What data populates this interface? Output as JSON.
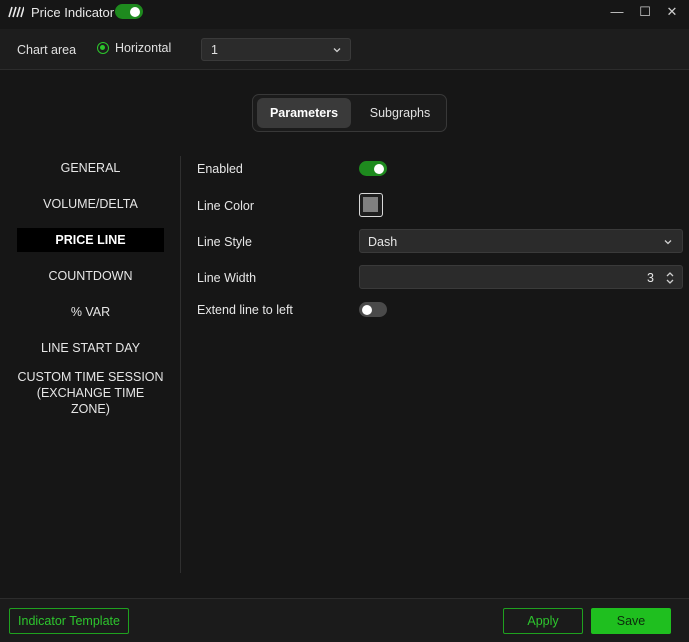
{
  "window": {
    "title": "Price Indicator",
    "enabled": true,
    "controls": {
      "minimize": "—",
      "maximize": "☐",
      "close": "✕"
    }
  },
  "chart_area": {
    "label": "Chart area",
    "radio_label": "Horizontal",
    "radio_selected": true,
    "select_value": "1"
  },
  "tabs": [
    {
      "label": "Parameters",
      "active": true
    },
    {
      "label": "Subgraphs",
      "active": false
    }
  ],
  "nav": [
    {
      "label": "GENERAL",
      "active": false
    },
    {
      "label": "VOLUME/DELTA",
      "active": false
    },
    {
      "label": "PRICE LINE",
      "active": true
    },
    {
      "label": "COUNTDOWN",
      "active": false
    },
    {
      "label": "% VAR",
      "active": false
    },
    {
      "label": "LINE START DAY",
      "active": false
    },
    {
      "label": "CUSTOM TIME SESSION",
      "label2": "(EXCHANGE TIME ZONE)",
      "active": false
    }
  ],
  "params": {
    "enabled": {
      "label": "Enabled",
      "value": true
    },
    "line_color": {
      "label": "Line Color",
      "color": "#808080"
    },
    "line_style": {
      "label": "Line Style",
      "value": "Dash"
    },
    "line_width": {
      "label": "Line Width",
      "value": "3"
    },
    "extend_left": {
      "label": "Extend line to left",
      "value": false
    }
  },
  "footer": {
    "template_label": "Indicator Template",
    "apply_label": "Apply",
    "save_label": "Save"
  },
  "colors": {
    "accent": "#1fbf1f",
    "toggle_on": "#1e8a1e",
    "background": "#161616"
  }
}
